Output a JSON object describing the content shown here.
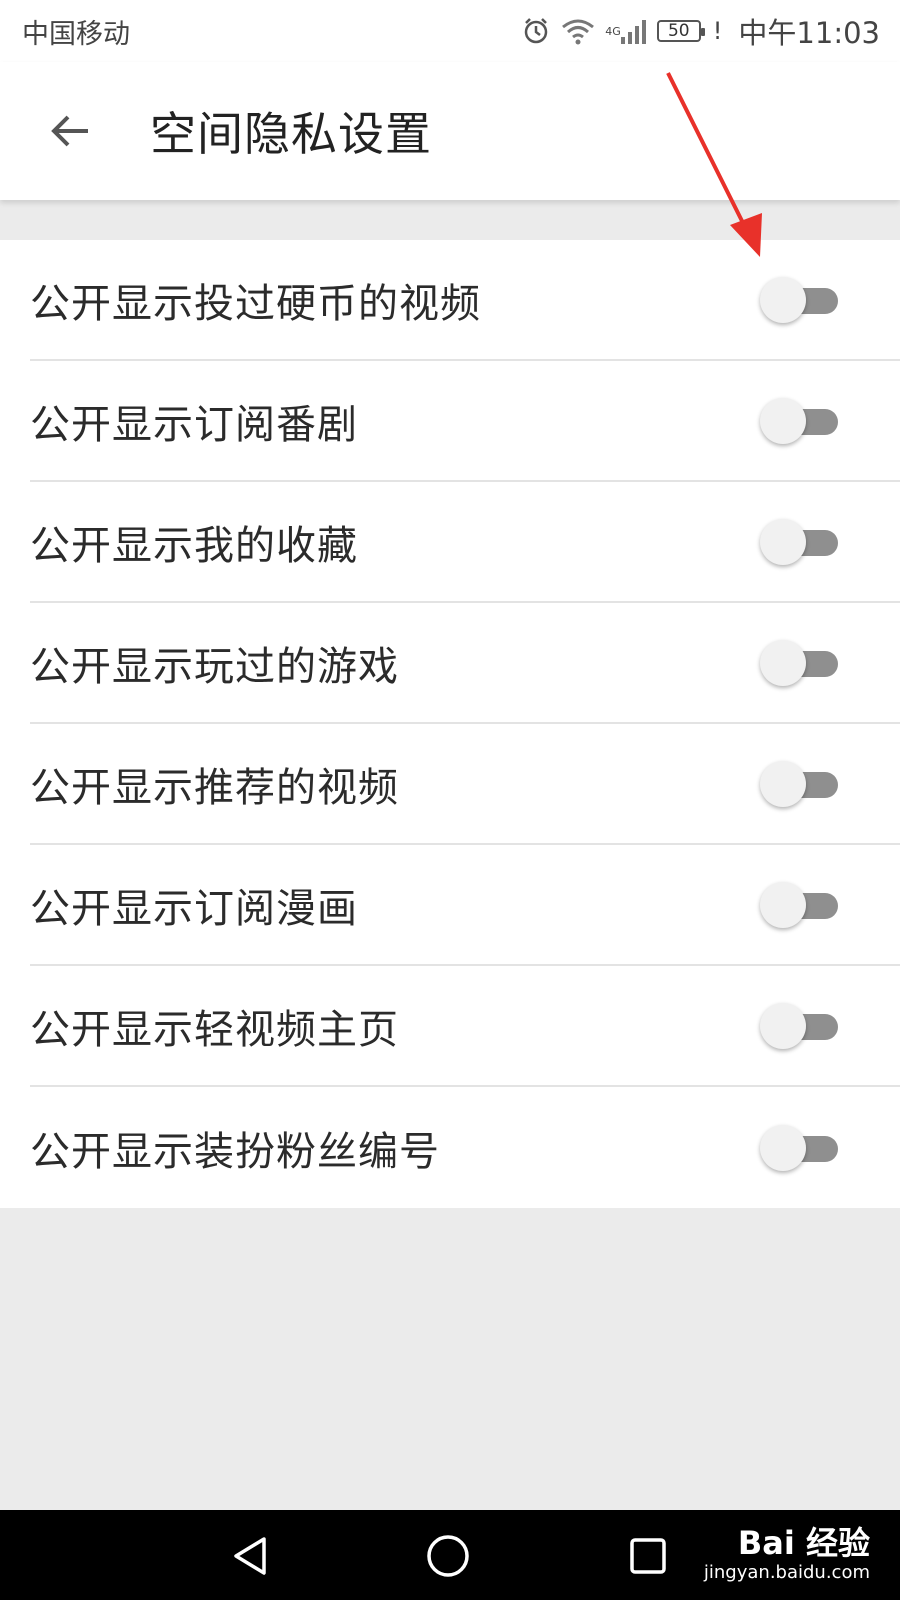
{
  "status_bar": {
    "carrier": "中国移动",
    "network": "4G",
    "battery": "50",
    "alert": "!",
    "time": "中午11:03",
    "icons": [
      "alarm-icon",
      "wifi-icon",
      "signal-icon",
      "battery-icon"
    ]
  },
  "app_bar": {
    "back_icon": "arrow-left-icon",
    "title": "空间隐私设置"
  },
  "settings": [
    {
      "label": "公开显示投过硬币的视频",
      "enabled": false
    },
    {
      "label": "公开显示订阅番剧",
      "enabled": false
    },
    {
      "label": "公开显示我的收藏",
      "enabled": false
    },
    {
      "label": "公开显示玩过的游戏",
      "enabled": false
    },
    {
      "label": "公开显示推荐的视频",
      "enabled": false
    },
    {
      "label": "公开显示订阅漫画",
      "enabled": false
    },
    {
      "label": "公开显示轻视频主页",
      "enabled": false
    },
    {
      "label": "公开显示装扮粉丝编号",
      "enabled": false
    }
  ],
  "annotation": {
    "color": "#e8312a",
    "icon": "red-arrow"
  },
  "nav_bar": {
    "icons": [
      "back-triangle-icon",
      "home-circle-icon",
      "recents-square-icon"
    ]
  },
  "watermark": {
    "brand": "Bai 经验",
    "url": "jingyan.baidu.com"
  },
  "colors": {
    "toggle_off_track": "#8f8f8f",
    "toggle_off_thumb": "#f1f1f1",
    "background": "#ebebeb"
  }
}
